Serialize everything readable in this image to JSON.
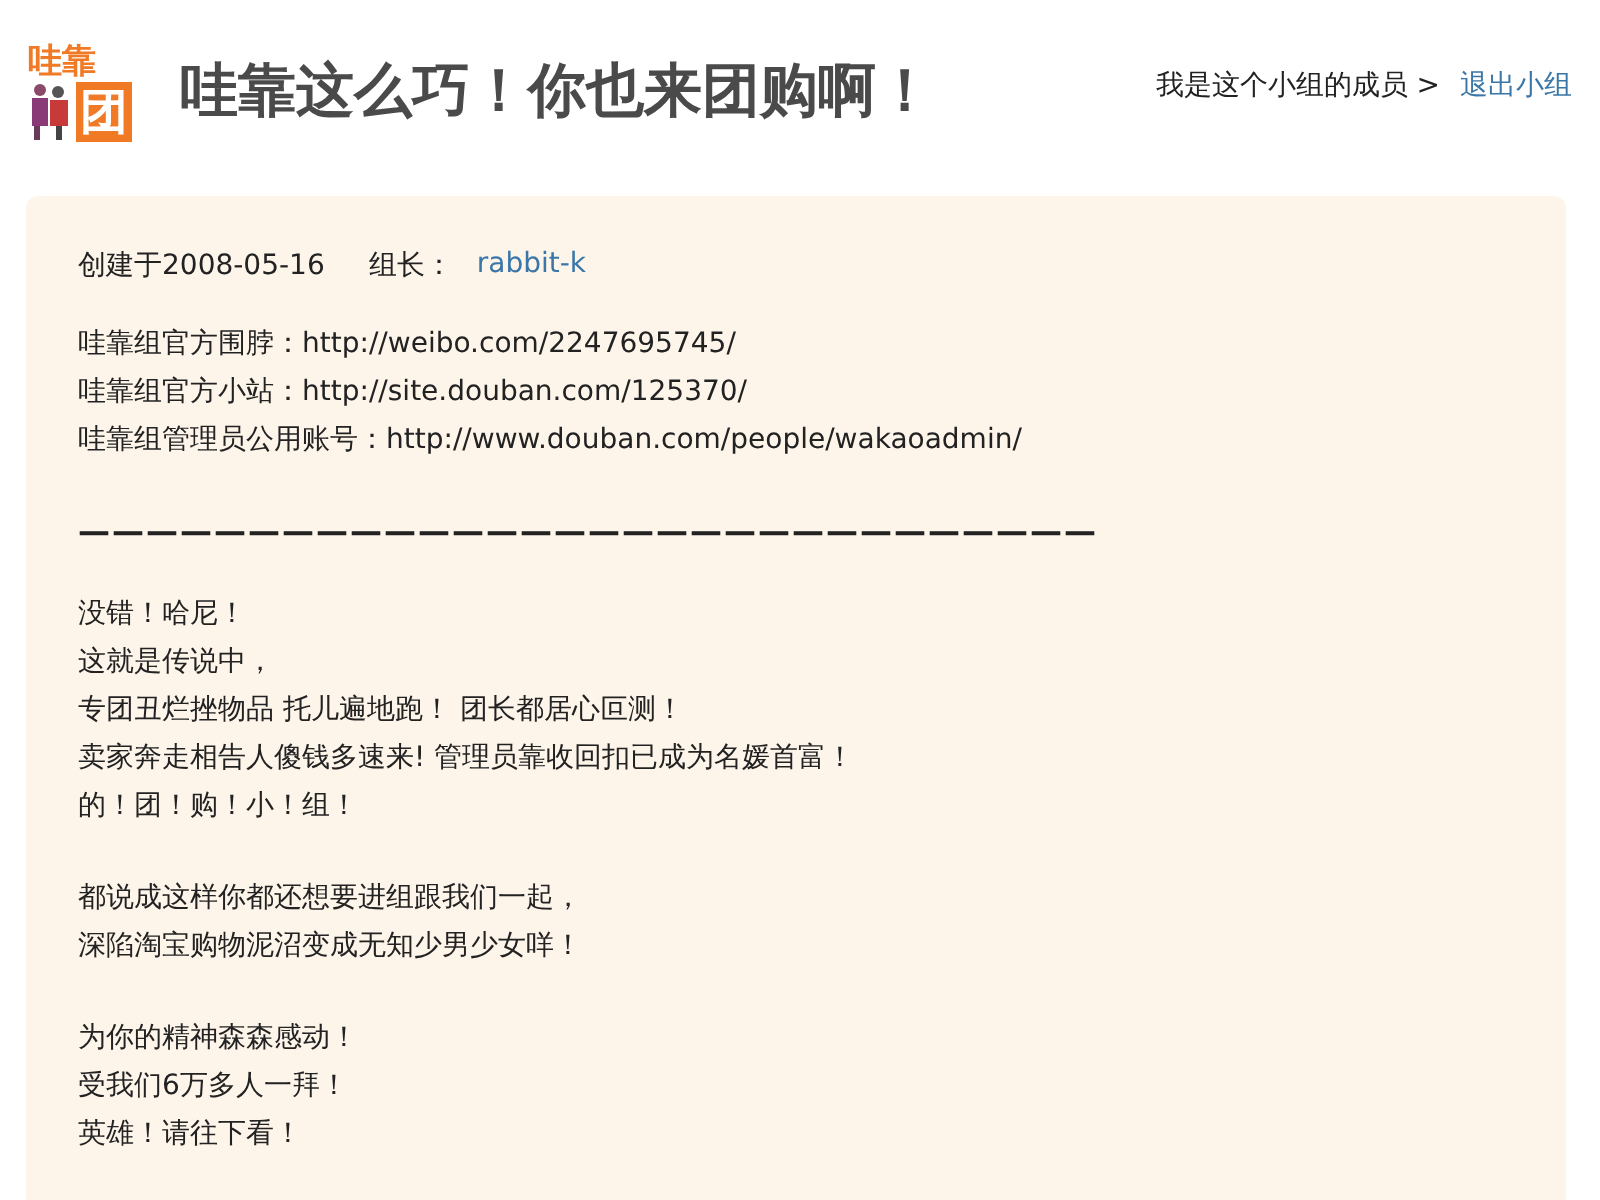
{
  "header": {
    "logo": {
      "top": "哇靠",
      "bottom": "团"
    },
    "title": "哇靠这么巧！你也来团购啊！",
    "membership": "我是这个小组的成员 >",
    "leave_link": "退出小组"
  },
  "info": {
    "created": "创建于2008-05-16",
    "owner_label": "组长：",
    "owner": "rabbit-k",
    "links": [
      {
        "label": "哇靠组官方围脖：",
        "url": "http://weibo.com/2247695745/"
      },
      {
        "label": "哇靠组官方小站：",
        "url": "http://site.douban.com/125370/"
      },
      {
        "label": "哇靠组管理员公用账号：",
        "url": "http://www.douban.com/people/wakaoadmin/"
      }
    ],
    "divider": "——————————————————————————————"
  },
  "paragraphs": [
    [
      "没错！哈尼！",
      "这就是传说中，",
      "专团丑烂挫物品 托儿遍地跑！ 团长都居心叵测！",
      "卖家奔走相告人傻钱多速来! 管理员靠收回扣已成为名媛首富！",
      "的！团！购！小！组！"
    ],
    [
      "都说成这样你都还想要进组跟我们一起，",
      "深陷淘宝购物泥沼变成无知少男少女咩！"
    ],
    [
      "为你的精神森森感动！",
      "受我们6万多人一拜！",
      "英雄！请往下看！"
    ]
  ]
}
